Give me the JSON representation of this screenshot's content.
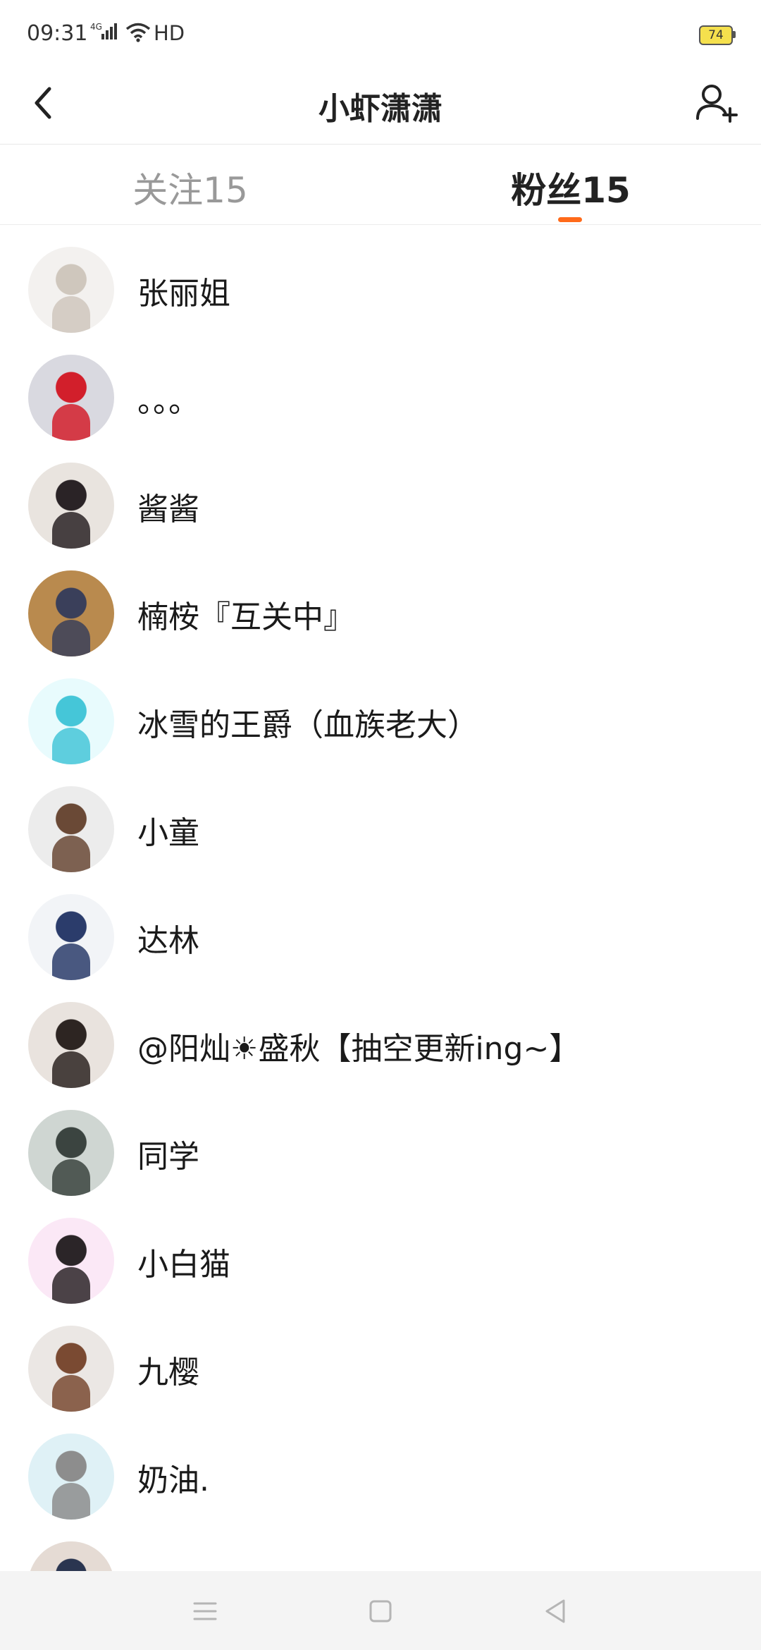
{
  "status_bar": {
    "time": "09:31",
    "network": "4G",
    "hd": "HD",
    "battery": "74",
    "battery_color": "#f5e04d"
  },
  "header": {
    "back_icon": "chevron-left-icon",
    "title": "小虾潇潇",
    "add_friend_icon": "add-user-icon"
  },
  "tabs": [
    {
      "label": "关注15",
      "active": false
    },
    {
      "label": "粉丝15",
      "active": true
    }
  ],
  "accent_color": "#ff6a1a",
  "fans": [
    {
      "name": "张丽姐",
      "avatar_colors": [
        "#f3f1ef",
        "#cfc7bd"
      ]
    },
    {
      "name": "。。。",
      "avatar_colors": [
        "#d9d9e0",
        "#d21f2b"
      ]
    },
    {
      "name": "酱酱",
      "avatar_colors": [
        "#e9e4df",
        "#2a2326"
      ]
    },
    {
      "name": "楠桉『互关中』",
      "avatar_colors": [
        "#b98a4e",
        "#3a3f5a"
      ]
    },
    {
      "name": "冰雪的王爵（血族老大）",
      "avatar_colors": [
        "#e8fbfd",
        "#45c6d8"
      ]
    },
    {
      "name": "小童",
      "avatar_colors": [
        "#ececec",
        "#6a4936"
      ]
    },
    {
      "name": "达林",
      "avatar_colors": [
        "#f2f4f7",
        "#2b3c6b"
      ]
    },
    {
      "name": "@阳灿☀盛秋【抽空更新ing~】",
      "avatar_colors": [
        "#e9e3de",
        "#2d2522"
      ]
    },
    {
      "name": "同学",
      "avatar_colors": [
        "#cfd6d2",
        "#3b4440"
      ]
    },
    {
      "name": "小白猫",
      "avatar_colors": [
        "#fbe8f6",
        "#2b2528"
      ]
    },
    {
      "name": "九樱",
      "avatar_colors": [
        "#ebe7e4",
        "#7a4a32"
      ]
    },
    {
      "name": "奶油.",
      "avatar_colors": [
        "#dff1f6",
        "#8d8d8d"
      ]
    },
    {
      "name": "",
      "avatar_colors": [
        "#e5dbd4",
        "#2a3550"
      ]
    }
  ],
  "nav_bar": {
    "menu_icon": "menu-icon",
    "home_icon": "home-square-icon",
    "back_icon": "back-triangle-icon"
  }
}
